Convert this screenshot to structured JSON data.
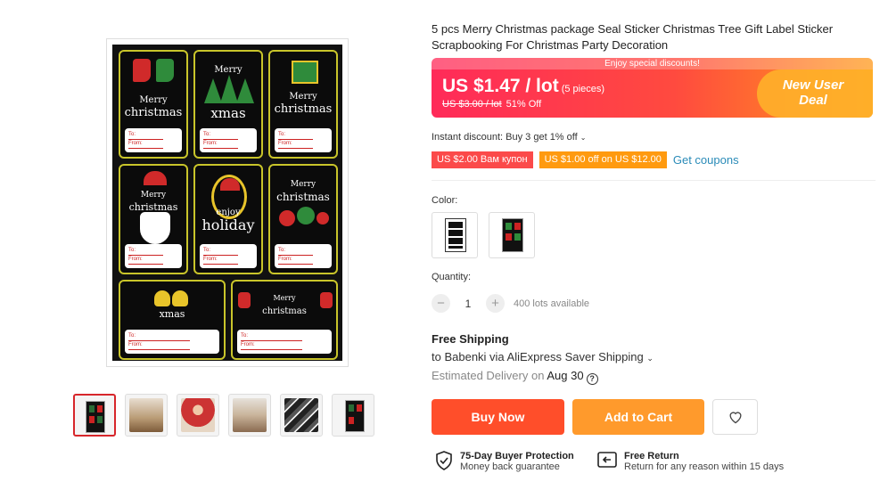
{
  "product": {
    "title": "5 pcs Merry Christmas package Seal Sticker Christmas Tree Gift Label Sticker Scrapbooking For Christmas Party Decoration"
  },
  "gallery": {
    "tags": [
      {
        "line1": "Merry",
        "line2": "christmas",
        "card_to": "To:",
        "card_from": "From:"
      },
      {
        "line1": "Merry",
        "line2": "xmas",
        "card_to": "To:",
        "card_from": "From:"
      },
      {
        "line1": "Merry",
        "line2": "christmas",
        "card_to": "To:",
        "card_from": "From:"
      },
      {
        "line1": "Merry",
        "line2": "christmas",
        "card_to": "To:",
        "card_from": "From:"
      },
      {
        "line1": "enjoy",
        "line2": "holiday",
        "card_to": "To:",
        "card_from": "From:"
      },
      {
        "line1": "Merry",
        "line2": "christmas",
        "card_to": "To:",
        "card_from": "From:"
      },
      {
        "line1": "",
        "line2": "xmas",
        "card_to": "To:",
        "card_from": "From:"
      },
      {
        "line1": "Merry",
        "line2": "christmas",
        "card_to": "To:",
        "card_from": "From:"
      }
    ],
    "thumbnail_count": 6
  },
  "price": {
    "banner": "Enjoy special discounts!",
    "current": "US $1.47 / lot",
    "unit_note": "(5 pieces)",
    "original": "US $3.00 / lot",
    "discount": "51% Off",
    "promo_line1": "New User",
    "promo_line2": "Deal"
  },
  "discounts": {
    "instant": "Instant discount: Buy 3 get 1% off",
    "coupon1": "US $2.00 Вам купон",
    "coupon2": "US $1.00 off on US $12.00",
    "get_coupons": "Get coupons"
  },
  "color": {
    "label": "Color:"
  },
  "quantity": {
    "label": "Quantity:",
    "value": "1",
    "minus": "−",
    "plus": "+",
    "available": "400 lots available"
  },
  "shipping": {
    "title": "Free Shipping",
    "to": "to Babenki via AliExpress Saver Shipping",
    "est_label": "Estimated Delivery on",
    "est_date": "Aug 30"
  },
  "actions": {
    "buy_now": "Buy Now",
    "add_to_cart": "Add to Cart"
  },
  "guarantees": [
    {
      "title": "75-Day Buyer Protection",
      "subtitle": "Money back guarantee"
    },
    {
      "title": "Free Return",
      "subtitle": "Return for any reason within 15 days"
    }
  ],
  "colors": {
    "accent": "#ff4e2a",
    "cart": "#ff9a2c",
    "link": "#2a8bb8"
  }
}
